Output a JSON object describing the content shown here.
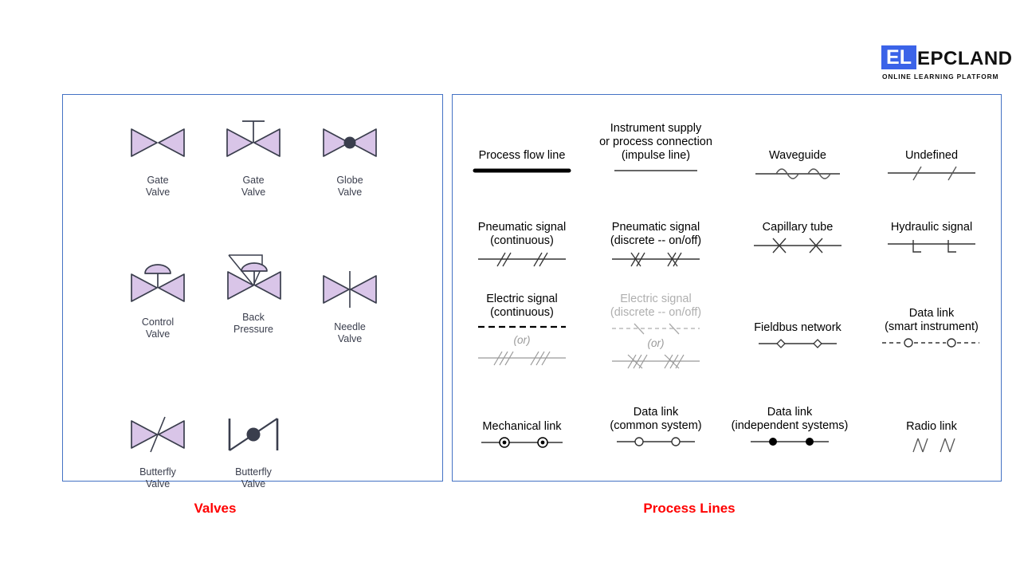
{
  "logo": {
    "badge_text": "EL",
    "word": "EPCLAND",
    "subtitle": "ONLINE LEARNING PLATFORM",
    "badge_color": "#3B63E8",
    "text_color": "#111111"
  },
  "captions": {
    "valves": "Valves",
    "process_lines": "Process Lines",
    "color": "#FF0000"
  },
  "panel_border_color": "#4472C4",
  "valves": {
    "symbol_fill": "#D9C5E8",
    "symbol_stroke": "#3A3E4D",
    "items": [
      {
        "id": "gate-valve-plain",
        "label": "Gate\nValve",
        "line1": "Gate",
        "line2": "Valve",
        "symbol": "gate-valve-symbol"
      },
      {
        "id": "gate-valve-stem",
        "label": "Gate\nValve",
        "line1": "Gate",
        "line2": "Valve",
        "symbol": "gate-valve-stem-symbol"
      },
      {
        "id": "globe-valve",
        "label": "Globe\nValve",
        "line1": "Globe",
        "line2": "Valve",
        "symbol": "globe-valve-symbol"
      },
      {
        "id": "control-valve",
        "label": "Control\nValve",
        "line1": "Control",
        "line2": "Valve",
        "symbol": "control-valve-symbol"
      },
      {
        "id": "back-pressure",
        "label": "Back\nPressure",
        "line1": "Back",
        "line2": "Pressure",
        "symbol": "back-pressure-valve-symbol"
      },
      {
        "id": "needle-valve",
        "label": "Needle\nValve",
        "line1": "Needle",
        "line2": "Valve",
        "symbol": "needle-valve-symbol"
      },
      {
        "id": "butterfly-valve-a",
        "label": "Butterfly\nValve",
        "line1": "Butterfly",
        "line2": "Valve",
        "symbol": "butterfly-valve-symbol"
      },
      {
        "id": "butterfly-valve-b",
        "label": "Butterfly\nValve",
        "line1": "Butterfly",
        "line2": "Valve",
        "symbol": "butterfly-valve-disc-symbol"
      }
    ]
  },
  "process_lines": {
    "items": [
      {
        "id": "process-flow-line",
        "label": "Process flow line",
        "symbol": "thick-solid-line",
        "dim": false
      },
      {
        "id": "instrument-supply",
        "label": "Instrument supply\nor process connection\n(impulse line)",
        "symbol": "thin-solid-line",
        "dim": false
      },
      {
        "id": "waveguide",
        "label": "Waveguide",
        "symbol": "sine-bump-line",
        "dim": false
      },
      {
        "id": "undefined-line",
        "label": "Undefined",
        "symbol": "single-slash-line",
        "dim": false
      },
      {
        "id": "pneumatic-continuous",
        "label": "Pneumatic signal\n(continuous)",
        "symbol": "double-slash-line",
        "dim": false
      },
      {
        "id": "pneumatic-discrete",
        "label": "Pneumatic signal\n(discrete -- on/off)",
        "symbol": "double-slash-crossed-line",
        "dim": false
      },
      {
        "id": "capillary-tube",
        "label": "Capillary tube",
        "symbol": "x-mark-line",
        "dim": false
      },
      {
        "id": "hydraulic-signal",
        "label": "Hydraulic signal",
        "symbol": "l-mark-line",
        "dim": false
      },
      {
        "id": "electric-continuous",
        "label": "Electric signal\n(continuous)",
        "symbol": "dashed-line",
        "dim": false,
        "or_text": "(or)",
        "alt_symbol": "triple-slash-line"
      },
      {
        "id": "electric-discrete",
        "label": "Electric signal\n(discrete -- on/off)",
        "symbol": "dashed-backslash-line",
        "dim": true,
        "or_text": "(or)",
        "alt_symbol": "triple-slash-crossed-line"
      },
      {
        "id": "fieldbus-network",
        "label": "Fieldbus network",
        "symbol": "diamond-node-line",
        "dim": false
      },
      {
        "id": "data-link-smart",
        "label": "Data link\n(smart instrument)",
        "symbol": "dashed-open-circle-line",
        "dim": false
      },
      {
        "id": "mechanical-link",
        "label": "Mechanical link",
        "symbol": "bullseye-node-line",
        "dim": false
      },
      {
        "id": "data-link-common",
        "label": "Data link\n(common system)",
        "symbol": "open-circle-node-line",
        "dim": false
      },
      {
        "id": "data-link-independent",
        "label": "Data link\n(independent systems)",
        "symbol": "filled-circle-node-line",
        "dim": false
      },
      {
        "id": "radio-link",
        "label": "Radio link",
        "symbol": "radio-zigzag-glyphs",
        "dim": false
      }
    ]
  }
}
